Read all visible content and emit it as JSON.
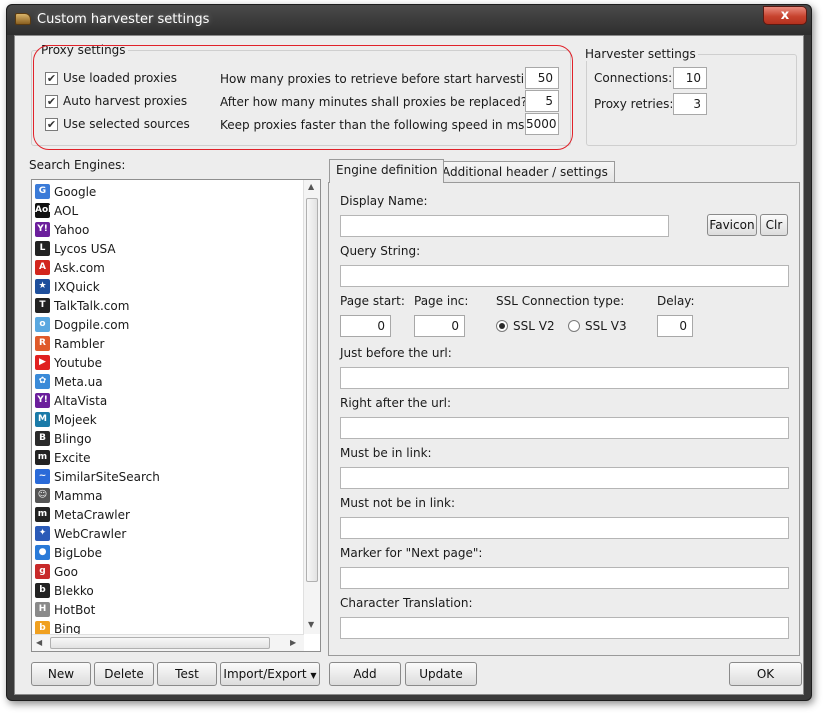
{
  "window": {
    "title": "Custom harvester settings",
    "close_label": "x"
  },
  "proxy_settings": {
    "title": "Proxy settings",
    "checkboxes": [
      {
        "label": "Use loaded proxies",
        "checked": true
      },
      {
        "label": "Auto harvest proxies",
        "checked": true
      },
      {
        "label": "Use selected sources",
        "checked": true
      }
    ],
    "fields": [
      {
        "label": "How many proxies to retrieve before start harvesting?",
        "value": "50"
      },
      {
        "label": "After how many minutes shall proxies be replaced?",
        "value": "5"
      },
      {
        "label": "Keep proxies faster than the following speed in ms:",
        "value": "5000"
      }
    ],
    "highlight_color": "#e0222a"
  },
  "harvester_settings": {
    "title": "Harvester settings",
    "connections_label": "Connections:",
    "connections_value": "10",
    "retries_label": "Proxy retries:",
    "retries_value": "3"
  },
  "search_engines": {
    "label": "Search Engines:",
    "items": [
      {
        "name": "Google",
        "icon": "google-icon",
        "color": "#3b7bd8",
        "glyph": "G"
      },
      {
        "name": "AOL",
        "icon": "aol-icon",
        "color": "#111111",
        "glyph": "Aol"
      },
      {
        "name": "Yahoo",
        "icon": "yahoo-icon",
        "color": "#6b1e9c",
        "glyph": "Y!"
      },
      {
        "name": "Lycos USA",
        "icon": "lycos-dog-icon",
        "color": "#222222",
        "glyph": "L"
      },
      {
        "name": "Ask.com",
        "icon": "ask-icon",
        "color": "#d2261e",
        "glyph": "A"
      },
      {
        "name": "IXQuick",
        "icon": "star-icon",
        "color": "#1e4f9c",
        "glyph": "★"
      },
      {
        "name": "TalkTalk.com",
        "icon": "talktalk-icon",
        "color": "#222222",
        "glyph": "T"
      },
      {
        "name": "Dogpile.com",
        "icon": "dogpile-icon",
        "color": "#5aa8e0",
        "glyph": "o"
      },
      {
        "name": "Rambler",
        "icon": "rambler-icon",
        "color": "#e05a2a",
        "glyph": "R"
      },
      {
        "name": "Youtube",
        "icon": "youtube-icon",
        "color": "#e02020",
        "glyph": "▶"
      },
      {
        "name": "Meta.ua",
        "icon": "meta-ua-icon",
        "color": "#3a8ad8",
        "glyph": "✿"
      },
      {
        "name": "AltaVista",
        "icon": "altavista-icon",
        "color": "#6b1e9c",
        "glyph": "Y!"
      },
      {
        "name": "Mojeek",
        "icon": "mojeek-icon",
        "color": "#1a7aa8",
        "glyph": "M"
      },
      {
        "name": "Blingo",
        "icon": "blingo-icon",
        "color": "#2a2a2a",
        "glyph": "B"
      },
      {
        "name": "Excite",
        "icon": "excite-icon",
        "color": "#222222",
        "glyph": "m"
      },
      {
        "name": "SimilarSiteSearch",
        "icon": "similarsite-icon",
        "color": "#2a6ad8",
        "glyph": "~"
      },
      {
        "name": "Mamma",
        "icon": "mamma-icon",
        "color": "#555555",
        "glyph": "☺"
      },
      {
        "name": "MetaCrawler",
        "icon": "metacrawler-icon",
        "color": "#222222",
        "glyph": "m"
      },
      {
        "name": "WebCrawler",
        "icon": "webcrawler-icon",
        "color": "#2a5ab8",
        "glyph": "✦"
      },
      {
        "name": "BigLobe",
        "icon": "biglobe-icon",
        "color": "#2a7ad8",
        "glyph": "●"
      },
      {
        "name": "Goo",
        "icon": "goo-icon",
        "color": "#c82a2a",
        "glyph": "g"
      },
      {
        "name": "Blekko",
        "icon": "blekko-icon",
        "color": "#222222",
        "glyph": "b"
      },
      {
        "name": "HotBot",
        "icon": "hotbot-icon",
        "color": "#8a8a8a",
        "glyph": "H"
      },
      {
        "name": "Bing",
        "icon": "bing-icon",
        "color": "#f0a020",
        "glyph": "b"
      }
    ],
    "buttons": {
      "new": "New",
      "delete": "Delete",
      "test": "Test",
      "import_export": "Import/Export"
    }
  },
  "tabs": [
    {
      "label": "Engine definition",
      "active": true
    },
    {
      "label": "Additional header / settings",
      "active": false
    }
  ],
  "engine_definition": {
    "display_name_label": "Display Name:",
    "display_name_value": "",
    "favicon_button": "Favicon",
    "clr_button": "Clr",
    "query_string_label": "Query String:",
    "query_string_value": "",
    "page_start_label": "Page start:",
    "page_start_value": "0",
    "page_inc_label": "Page inc:",
    "page_inc_value": "0",
    "ssl_label": "SSL Connection type:",
    "ssl_options": [
      {
        "label": "SSL V2",
        "selected": true
      },
      {
        "label": "SSL V3",
        "selected": false
      }
    ],
    "delay_label": "Delay:",
    "delay_value": "0",
    "just_before_label": "Just before the url:",
    "right_after_label": "Right after the url:",
    "must_be_label": "Must be in link:",
    "must_not_be_label": "Must not be in link:",
    "marker_next_label": "Marker for \"Next page\":",
    "char_translation_label": "Character Translation:"
  },
  "footer": {
    "add": "Add",
    "update": "Update",
    "ok": "OK"
  }
}
